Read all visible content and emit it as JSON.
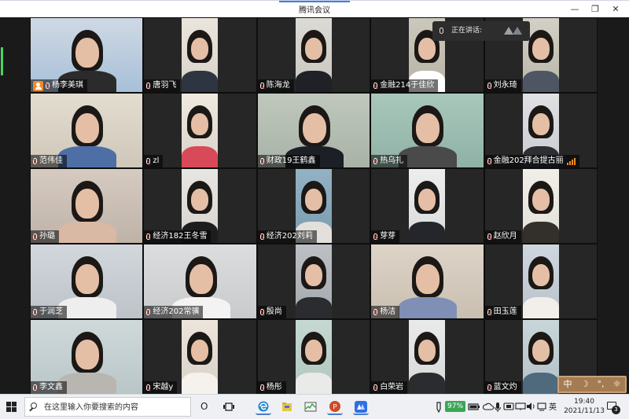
{
  "app": {
    "title": "腾讯会议"
  },
  "window_controls": {
    "minimize": "—",
    "restore": "❐",
    "close": "✕"
  },
  "speaking": {
    "label": "正在讲话:"
  },
  "participants": [
    {
      "name": "杨李美琪",
      "host": true,
      "bg": "#a7c0d8",
      "body": "#2b2b2b",
      "wall": "#cfd9e4"
    },
    {
      "name": "唐羽飞",
      "bg": "#d6d1c9",
      "body": "#2e3540",
      "wall": "#ebe6dd"
    },
    {
      "name": "陈海龙",
      "bg": "#c9c6bf",
      "body": "#1f2126",
      "wall": "#dcdad5"
    },
    {
      "name": "金融214于佳欣",
      "bg": "#b7b3a4",
      "body": "#ffffff",
      "wall": "#cbc8bc"
    },
    {
      "name": "刘永琦",
      "bg": "#b9b5a8",
      "body": "#4e5663",
      "wall": "#d3d0c6"
    },
    {
      "name": "范伟佳",
      "bg": "#cfc7b9",
      "body": "#4e6fa6",
      "wall": "#e3ddd0"
    },
    {
      "name": "zl",
      "bg": "#d8d2c8",
      "body": "#d84a57",
      "wall": "#efe9df"
    },
    {
      "name": "财政19王鹤鑫",
      "bg": "#a8b2a6",
      "body": "#1c1f25",
      "wall": "#c0c8be"
    },
    {
      "name": "热乌扎",
      "bg": "#8fb2a6",
      "body": "#4a4a4a",
      "wall": "#a9c7bb"
    },
    {
      "name": "金融202拜合提古丽",
      "bg": "#c9cbd0",
      "body": "#2d2f34",
      "wall": "#dfe1e4",
      "signal": true
    },
    {
      "name": "孙璐",
      "bg": "#bfb3a8",
      "body": "#d9b8a4",
      "wall": "#d6cbc1"
    },
    {
      "name": "经济182王冬雪",
      "bg": "#d6d3ce",
      "body": "#1d1d1d",
      "wall": "#e8e6e2"
    },
    {
      "name": "经济202刘莉",
      "bg": "#7a9bb0",
      "body": "#e3e0dc",
      "wall": "#93b2c4"
    },
    {
      "name": "芽芽",
      "bg": "#d9dadc",
      "body": "#24262b",
      "wall": "#eceded"
    },
    {
      "name": "赵欣月",
      "bg": "#e3e0da",
      "body": "#33302c",
      "wall": "#f1eee8"
    },
    {
      "name": "于润芝",
      "bg": "#bcc3c9",
      "body": "#eeeeee",
      "wall": "#d2d7dc"
    },
    {
      "name": "经济202常骥",
      "bg": "#c8cacc",
      "body": "#f3f3f3",
      "wall": "#dcdddf"
    },
    {
      "name": "殷尚",
      "bg": "#a4a9ad",
      "body": "#2a2c30",
      "wall": "#bcc0c4"
    },
    {
      "name": "杨洁",
      "bg": "#c9bfb1",
      "body": "#7f8fb5",
      "wall": "#ddd4c7"
    },
    {
      "name": "田玉莲",
      "bg": "#b9c2cc",
      "body": "#f2efea",
      "wall": "#cfd6de"
    },
    {
      "name": "李文鑫",
      "bg": "#b9c6c8",
      "body": "#b9b5b1",
      "wall": "#cfd9da"
    },
    {
      "name": "宋越y",
      "bg": "#d7d0c6",
      "body": "#f5f2ee",
      "wall": "#ebe5dc"
    },
    {
      "name": "杨彤",
      "bg": "#b0c6bf",
      "body": "#eaeae8",
      "wall": "#c6d8d2"
    },
    {
      "name": "白荣岩",
      "bg": "#d7d8d8",
      "body": "#2a2c30",
      "wall": "#e9eaea"
    },
    {
      "name": "蓝文灼",
      "bg": "#b3c2c7",
      "body": "#4e6a7c",
      "wall": "#c8d5d9"
    }
  ],
  "ime": {
    "mode": "中",
    "moon": "☽",
    "punct": "°,",
    "gear": "☼"
  },
  "taskbar": {
    "search_placeholder": "在这里输入你要搜索的内容",
    "cortana": "O",
    "battery": "97%",
    "time": "19:40",
    "date": "2021/11/13",
    "notifications": "3"
  }
}
